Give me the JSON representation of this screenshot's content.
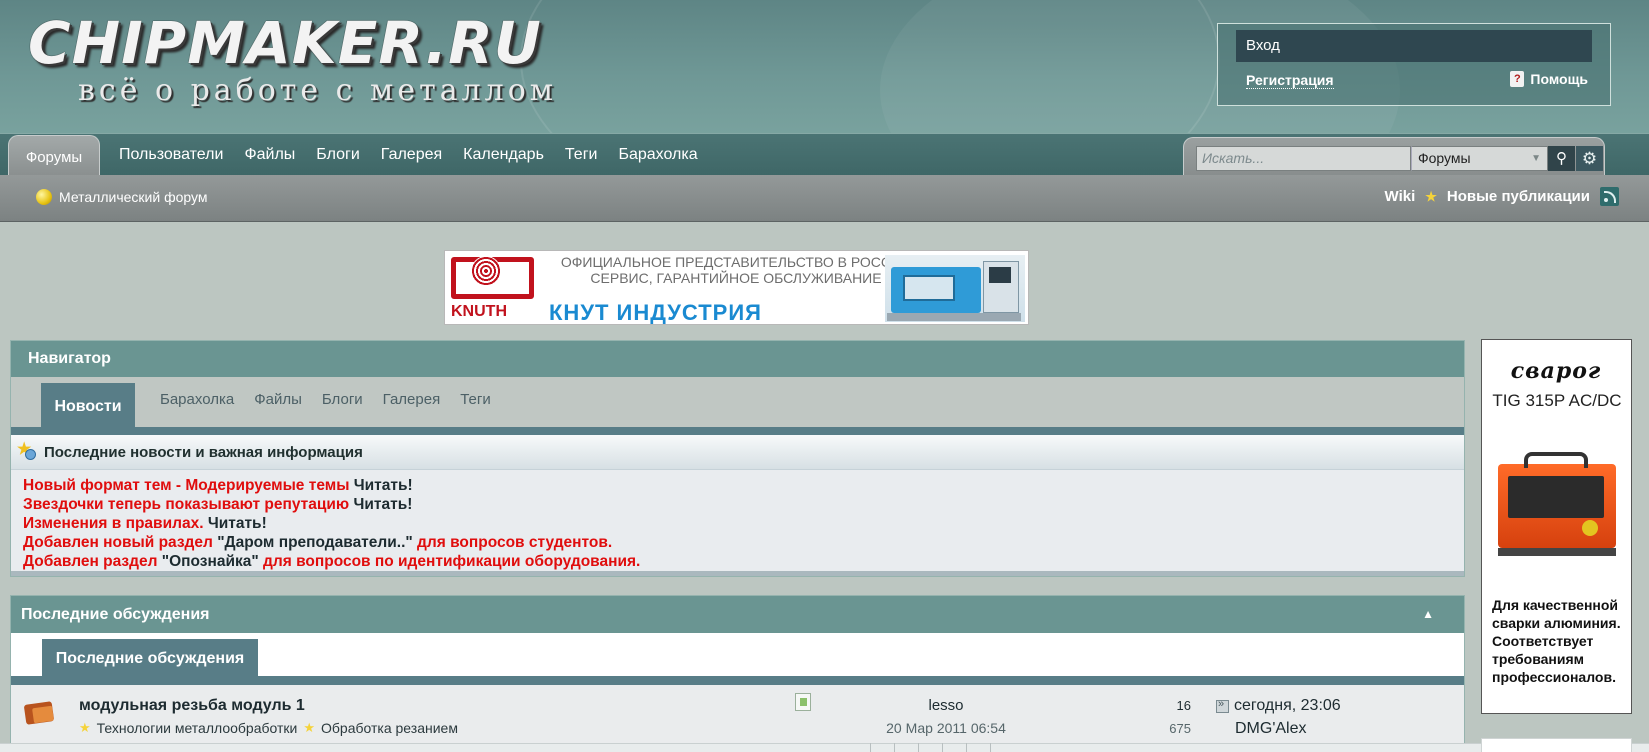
{
  "logo": {
    "title": "CHIPMAKER.RU",
    "subtitle": "всё о работе с металлом"
  },
  "account": {
    "login_label": "Вход",
    "register_label": "Регистрация",
    "help_label": "Помощь"
  },
  "nav": {
    "active_tab": "Форумы",
    "links": [
      "Пользователи",
      "Файлы",
      "Блоги",
      "Галерея",
      "Календарь",
      "Теги",
      "Барахолка"
    ]
  },
  "search": {
    "placeholder": "Искать...",
    "scope_value": "Форумы",
    "search_icon": "magnifier-icon",
    "settings_icon": "gear-icon"
  },
  "subbar": {
    "breadcrumb": "Металлический форум",
    "wiki_label": "Wiki",
    "new_posts_label": "Новые публикации"
  },
  "banner": {
    "brand_logo": "KNUTH",
    "line1": "ОФИЦИАЛЬНОЕ ПРЕДСТАВИТЕЛЬСТВО В РОССИИ",
    "line2": "СЕРВИС, ГАРАНТИЙНОЕ ОБСЛУЖИВАНИЕ",
    "brand_name": "КНУТ ИНДУСТРИЯ"
  },
  "navigator": {
    "title": "Навигатор",
    "active_tab": "Новости",
    "tabs": [
      "Барахолка",
      "Файлы",
      "Блоги",
      "Галерея",
      "Теги"
    ],
    "news_header": "Последние новости и важная информация",
    "news": [
      {
        "red": "Новый формат тем - Модерируемые темы",
        "dark": " Читать!",
        "red2": "",
        "dark0": ""
      },
      {
        "red": "Звездочки теперь показывают репутацию",
        "dark": " Читать!",
        "red2": "",
        "dark0": ""
      },
      {
        "red": "Изменения в правилах.",
        "dark": " Читать!",
        "red2": "",
        "dark0": ""
      },
      {
        "red": "Добавлен новый раздел ",
        "dark0": "\"Даром преподаватели..\"",
        "red2": " для вопросов студентов.",
        "dark": ""
      },
      {
        "red": "Добавлен раздел ",
        "dark0": "\"Опознайка\"",
        "red2": " для вопросов по идентификации оборудования.",
        "dark": ""
      }
    ]
  },
  "discussions": {
    "title": "Последние обсуждения",
    "active_tab": "Последние обсуждения",
    "rows": [
      {
        "title": "модульная резьба модуль 1",
        "category1": "Технологии металлообработки",
        "category2": "Обработка резанием",
        "author": "lesso",
        "date": "20 Мар 2011 06:54",
        "replies": "16",
        "views": "675",
        "last_time": "сегодня, 23:06",
        "last_user": "DMG'Alex"
      }
    ]
  },
  "side_ad": {
    "brand": "сварог",
    "model": "TIG 315P AC/DC",
    "text": "Для качественной сварки алюминия. Соответствует требованиям профессионалов."
  },
  "colors": {
    "header_bg": "#6f9896",
    "accent_teal": "#6a9592",
    "tab_dark": "#587d87",
    "news_red": "#e00d0d"
  }
}
